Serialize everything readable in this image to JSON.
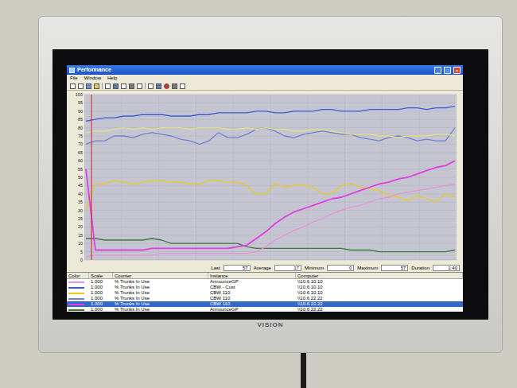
{
  "window": {
    "title": "Performance",
    "buttons": [
      "_",
      "□",
      "×"
    ]
  },
  "menu": [
    "File",
    "Window",
    "Help"
  ],
  "chart": {
    "y_ticks": [
      "100",
      "95",
      "90",
      "85",
      "80",
      "75",
      "70",
      "65",
      "60",
      "55",
      "50",
      "45",
      "40",
      "35",
      "30",
      "25",
      "20",
      "15",
      "10",
      "5",
      "0"
    ],
    "series": [
      {
        "color": "#3b5bd9",
        "values": [
          84,
          85,
          86,
          86,
          87,
          87,
          88,
          88,
          88,
          87,
          87,
          87,
          88,
          88,
          89,
          89,
          89,
          89,
          90,
          90,
          89,
          89,
          90,
          90,
          90,
          91,
          91,
          90,
          90,
          90,
          91,
          91,
          91,
          91,
          92,
          92,
          91,
          92,
          92,
          93
        ]
      },
      {
        "color": "#7084cc",
        "values": [
          70,
          72,
          72,
          75,
          75,
          74,
          76,
          77,
          76,
          75,
          73,
          72,
          70,
          72,
          77,
          74,
          74,
          76,
          79,
          80,
          78,
          75,
          74,
          76,
          77,
          78,
          77,
          76,
          76,
          74,
          73,
          72,
          74,
          75,
          74,
          72,
          73,
          72,
          72,
          80
        ]
      },
      {
        "color": "#e6de84",
        "values": [
          77,
          78,
          78,
          79,
          80,
          79,
          80,
          79,
          80,
          80,
          80,
          79,
          80,
          80,
          80,
          79,
          79,
          80,
          79,
          80,
          79,
          79,
          78,
          78,
          79,
          79,
          78,
          77,
          76,
          76,
          76,
          75,
          75,
          74,
          75,
          75,
          75,
          76,
          76,
          75
        ]
      },
      {
        "color": "#e8cc1c",
        "values": [
          30,
          46,
          46,
          48,
          47,
          46,
          47,
          48,
          48,
          47,
          47,
          46,
          46,
          48,
          48,
          47,
          47,
          45,
          40,
          40,
          46,
          44,
          45,
          45,
          44,
          40,
          40,
          45,
          46,
          44,
          43,
          42,
          39,
          38,
          36,
          39,
          37,
          35,
          40,
          38
        ]
      },
      {
        "color": "#3c7a3c",
        "values": [
          13,
          13,
          12,
          12,
          12,
          12,
          12,
          13,
          12,
          10,
          10,
          10,
          10,
          10,
          10,
          10,
          10,
          8,
          7,
          7,
          7,
          7,
          7,
          7,
          7,
          7,
          7,
          7,
          6,
          6,
          6,
          5,
          5,
          5,
          5,
          5,
          5,
          5,
          5,
          6
        ]
      },
      {
        "color": "#e03ee0",
        "values": [
          55,
          6,
          6,
          6,
          6,
          6,
          6,
          7,
          7,
          7,
          7,
          7,
          7,
          7,
          7,
          7,
          8,
          9,
          13,
          17,
          22,
          26,
          29,
          31,
          33,
          35,
          37,
          38,
          40,
          42,
          44,
          46,
          47,
          49,
          50,
          52,
          54,
          56,
          57,
          60
        ]
      },
      {
        "color": "#e892d8",
        "values": [
          2,
          3,
          3,
          3,
          3,
          3,
          3,
          3,
          4,
          4,
          4,
          4,
          4,
          4,
          4,
          4,
          4,
          4,
          5,
          8,
          12,
          15,
          18,
          20,
          23,
          25,
          28,
          30,
          32,
          33,
          35,
          37,
          38,
          40,
          41,
          42,
          43,
          44,
          45,
          46
        ]
      }
    ]
  },
  "stats": [
    {
      "label": "Last",
      "value": "57"
    },
    {
      "label": "Average",
      "value": "17"
    },
    {
      "label": "Minimum",
      "value": "0"
    },
    {
      "label": "Maximum",
      "value": "57"
    },
    {
      "label": "Duration",
      "value": "1:40"
    }
  ],
  "table": {
    "columns": [
      "Color",
      "Scale",
      "Counter",
      "Instance",
      "Computer"
    ],
    "rows": [
      {
        "color": "#e892d8",
        "selected": false,
        "cells": [
          "1.000",
          "% Trunks In Use",
          "AnnounceGP",
          "\\\\10.6.10.10"
        ]
      },
      {
        "color": "#3b5bd9",
        "selected": false,
        "cells": [
          "1.000",
          "% Trunks In Use",
          "CBW - Cust",
          "\\\\10.6.10.10"
        ]
      },
      {
        "color": "#e8cc1c",
        "selected": false,
        "cells": [
          "1.000",
          "% Trunks In Use",
          "CBW 110",
          "\\\\10.6.10.10"
        ]
      },
      {
        "color": "#7084cc",
        "selected": false,
        "cells": [
          "1.000",
          "% Trunks In Use",
          "CBW 110",
          "\\\\10.6.22.22"
        ]
      },
      {
        "color": "#e03ee0",
        "selected": true,
        "cells": [
          "1.000",
          "% Trunks In Use",
          "CBW 110",
          "\\\\10.6.22.22"
        ]
      },
      {
        "color": "#3c7a3c",
        "selected": false,
        "cells": [
          "1.000",
          "% Trunks In Use",
          "AnnounceGP",
          "\\\\10.6.22.22"
        ]
      }
    ]
  },
  "monitor": {
    "brand": "VISION"
  }
}
